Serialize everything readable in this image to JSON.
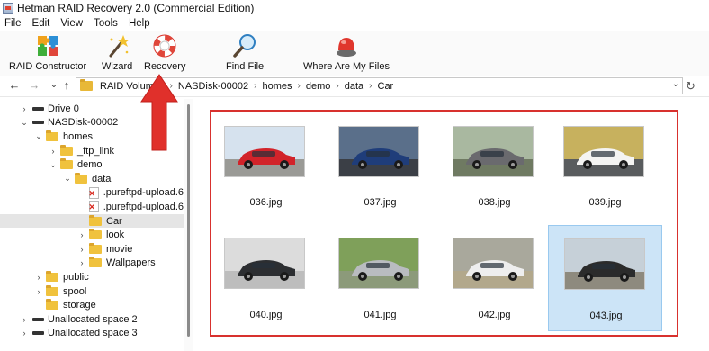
{
  "window": {
    "title": "Hetman RAID Recovery 2.0 (Commercial Edition)"
  },
  "menu": [
    "File",
    "Edit",
    "View",
    "Tools",
    "Help"
  ],
  "toolbar": {
    "raid_constructor": "RAID Constructor",
    "wizard": "Wizard",
    "recovery": "Recovery",
    "find_file": "Find File",
    "where_files": "Where Are My Files"
  },
  "address": {
    "crumbs": [
      "RAID Volumes",
      "NASDisk-00002",
      "homes",
      "demo",
      "data",
      "Car"
    ]
  },
  "tree": [
    {
      "label": "Drive 0",
      "indent": 0,
      "type": "drive",
      "chev": "›"
    },
    {
      "label": "NASDisk-00002",
      "indent": 0,
      "type": "drive",
      "chev": "⌄"
    },
    {
      "label": "homes",
      "indent": 1,
      "type": "folder",
      "chev": "⌄"
    },
    {
      "label": "_ftp_link",
      "indent": 2,
      "type": "folder",
      "chev": "›"
    },
    {
      "label": "demo",
      "indent": 2,
      "type": "folder",
      "chev": "⌄"
    },
    {
      "label": "data",
      "indent": 3,
      "type": "folder",
      "chev": "⌄"
    },
    {
      "label": ".pureftpd-upload.6",
      "indent": 4,
      "type": "file",
      "chev": ""
    },
    {
      "label": ".pureftpd-upload.6",
      "indent": 4,
      "type": "file",
      "chev": ""
    },
    {
      "label": "Car",
      "indent": 4,
      "type": "folder",
      "chev": "",
      "selected": true
    },
    {
      "label": "look",
      "indent": 4,
      "type": "folder",
      "chev": "›"
    },
    {
      "label": "movie",
      "indent": 4,
      "type": "folder",
      "chev": "›"
    },
    {
      "label": "Wallpapers",
      "indent": 4,
      "type": "folder",
      "chev": "›"
    },
    {
      "label": "public",
      "indent": 1,
      "type": "folder",
      "chev": "›"
    },
    {
      "label": "spool",
      "indent": 1,
      "type": "folder",
      "chev": "›"
    },
    {
      "label": "storage",
      "indent": 1,
      "type": "folder",
      "chev": ""
    },
    {
      "label": "Unallocated space 2",
      "indent": 0,
      "type": "drive",
      "chev": "›"
    },
    {
      "label": "Unallocated space 3",
      "indent": 0,
      "type": "drive",
      "chev": "›"
    }
  ],
  "files": [
    {
      "name": "036.jpg",
      "sky": "#d6e2ee",
      "ground": "#9a9a96",
      "car": "#d2232a",
      "selected": false
    },
    {
      "name": "037.jpg",
      "sky": "#5a6f8a",
      "ground": "#3b3f46",
      "car": "#1f3d7a",
      "selected": false
    },
    {
      "name": "038.jpg",
      "sky": "#a9b8a0",
      "ground": "#6f7a62",
      "car": "#6a6a6e",
      "selected": false
    },
    {
      "name": "039.jpg",
      "sky": "#c7b15e",
      "ground": "#595c5e",
      "car": "#f4f4f2",
      "selected": false
    },
    {
      "name": "040.jpg",
      "sky": "#dcdcdc",
      "ground": "#bdbdbd",
      "car": "#2c2e31",
      "selected": false
    },
    {
      "name": "041.jpg",
      "sky": "#7fa05a",
      "ground": "#8c9a7a",
      "car": "#b9bcc0",
      "selected": false
    },
    {
      "name": "042.jpg",
      "sky": "#a9a89c",
      "ground": "#b2a88c",
      "car": "#eeeeee",
      "selected": false
    },
    {
      "name": "043.jpg",
      "sky": "#c6d0d8",
      "ground": "#8e8a7e",
      "car": "#2b2b2b",
      "selected": true
    }
  ],
  "colors": {
    "annotation_red": "#e0302b",
    "selection_blue": "#cce4f7"
  }
}
